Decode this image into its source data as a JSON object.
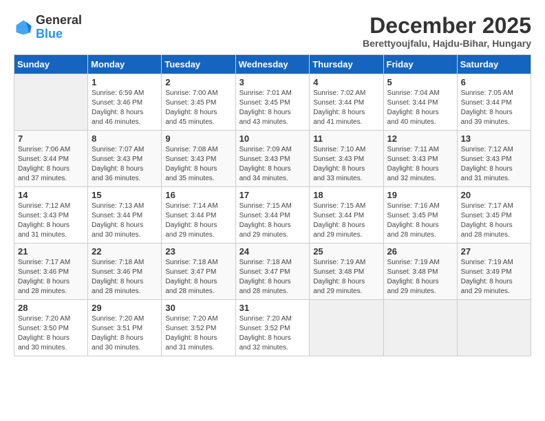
{
  "logo": {
    "general": "General",
    "blue": "Blue"
  },
  "header": {
    "title": "December 2025",
    "subtitle": "Berettyoujfalu, Hajdu-Bihar, Hungary"
  },
  "weekdays": [
    "Sunday",
    "Monday",
    "Tuesday",
    "Wednesday",
    "Thursday",
    "Friday",
    "Saturday"
  ],
  "weeks": [
    [
      {
        "day": "",
        "info": ""
      },
      {
        "day": "1",
        "info": "Sunrise: 6:59 AM\nSunset: 3:46 PM\nDaylight: 8 hours\nand 46 minutes."
      },
      {
        "day": "2",
        "info": "Sunrise: 7:00 AM\nSunset: 3:45 PM\nDaylight: 8 hours\nand 45 minutes."
      },
      {
        "day": "3",
        "info": "Sunrise: 7:01 AM\nSunset: 3:45 PM\nDaylight: 8 hours\nand 43 minutes."
      },
      {
        "day": "4",
        "info": "Sunrise: 7:02 AM\nSunset: 3:44 PM\nDaylight: 8 hours\nand 41 minutes."
      },
      {
        "day": "5",
        "info": "Sunrise: 7:04 AM\nSunset: 3:44 PM\nDaylight: 8 hours\nand 40 minutes."
      },
      {
        "day": "6",
        "info": "Sunrise: 7:05 AM\nSunset: 3:44 PM\nDaylight: 8 hours\nand 39 minutes."
      }
    ],
    [
      {
        "day": "7",
        "info": "Sunrise: 7:06 AM\nSunset: 3:44 PM\nDaylight: 8 hours\nand 37 minutes."
      },
      {
        "day": "8",
        "info": "Sunrise: 7:07 AM\nSunset: 3:43 PM\nDaylight: 8 hours\nand 36 minutes."
      },
      {
        "day": "9",
        "info": "Sunrise: 7:08 AM\nSunset: 3:43 PM\nDaylight: 8 hours\nand 35 minutes."
      },
      {
        "day": "10",
        "info": "Sunrise: 7:09 AM\nSunset: 3:43 PM\nDaylight: 8 hours\nand 34 minutes."
      },
      {
        "day": "11",
        "info": "Sunrise: 7:10 AM\nSunset: 3:43 PM\nDaylight: 8 hours\nand 33 minutes."
      },
      {
        "day": "12",
        "info": "Sunrise: 7:11 AM\nSunset: 3:43 PM\nDaylight: 8 hours\nand 32 minutes."
      },
      {
        "day": "13",
        "info": "Sunrise: 7:12 AM\nSunset: 3:43 PM\nDaylight: 8 hours\nand 31 minutes."
      }
    ],
    [
      {
        "day": "14",
        "info": "Sunrise: 7:12 AM\nSunset: 3:43 PM\nDaylight: 8 hours\nand 31 minutes."
      },
      {
        "day": "15",
        "info": "Sunrise: 7:13 AM\nSunset: 3:44 PM\nDaylight: 8 hours\nand 30 minutes."
      },
      {
        "day": "16",
        "info": "Sunrise: 7:14 AM\nSunset: 3:44 PM\nDaylight: 8 hours\nand 29 minutes."
      },
      {
        "day": "17",
        "info": "Sunrise: 7:15 AM\nSunset: 3:44 PM\nDaylight: 8 hours\nand 29 minutes."
      },
      {
        "day": "18",
        "info": "Sunrise: 7:15 AM\nSunset: 3:44 PM\nDaylight: 8 hours\nand 29 minutes."
      },
      {
        "day": "19",
        "info": "Sunrise: 7:16 AM\nSunset: 3:45 PM\nDaylight: 8 hours\nand 28 minutes."
      },
      {
        "day": "20",
        "info": "Sunrise: 7:17 AM\nSunset: 3:45 PM\nDaylight: 8 hours\nand 28 minutes."
      }
    ],
    [
      {
        "day": "21",
        "info": "Sunrise: 7:17 AM\nSunset: 3:46 PM\nDaylight: 8 hours\nand 28 minutes."
      },
      {
        "day": "22",
        "info": "Sunrise: 7:18 AM\nSunset: 3:46 PM\nDaylight: 8 hours\nand 28 minutes."
      },
      {
        "day": "23",
        "info": "Sunrise: 7:18 AM\nSunset: 3:47 PM\nDaylight: 8 hours\nand 28 minutes."
      },
      {
        "day": "24",
        "info": "Sunrise: 7:18 AM\nSunset: 3:47 PM\nDaylight: 8 hours\nand 28 minutes."
      },
      {
        "day": "25",
        "info": "Sunrise: 7:19 AM\nSunset: 3:48 PM\nDaylight: 8 hours\nand 29 minutes."
      },
      {
        "day": "26",
        "info": "Sunrise: 7:19 AM\nSunset: 3:48 PM\nDaylight: 8 hours\nand 29 minutes."
      },
      {
        "day": "27",
        "info": "Sunrise: 7:19 AM\nSunset: 3:49 PM\nDaylight: 8 hours\nand 29 minutes."
      }
    ],
    [
      {
        "day": "28",
        "info": "Sunrise: 7:20 AM\nSunset: 3:50 PM\nDaylight: 8 hours\nand 30 minutes."
      },
      {
        "day": "29",
        "info": "Sunrise: 7:20 AM\nSunset: 3:51 PM\nDaylight: 8 hours\nand 30 minutes."
      },
      {
        "day": "30",
        "info": "Sunrise: 7:20 AM\nSunset: 3:52 PM\nDaylight: 8 hours\nand 31 minutes."
      },
      {
        "day": "31",
        "info": "Sunrise: 7:20 AM\nSunset: 3:52 PM\nDaylight: 8 hours\nand 32 minutes."
      },
      {
        "day": "",
        "info": ""
      },
      {
        "day": "",
        "info": ""
      },
      {
        "day": "",
        "info": ""
      }
    ]
  ]
}
